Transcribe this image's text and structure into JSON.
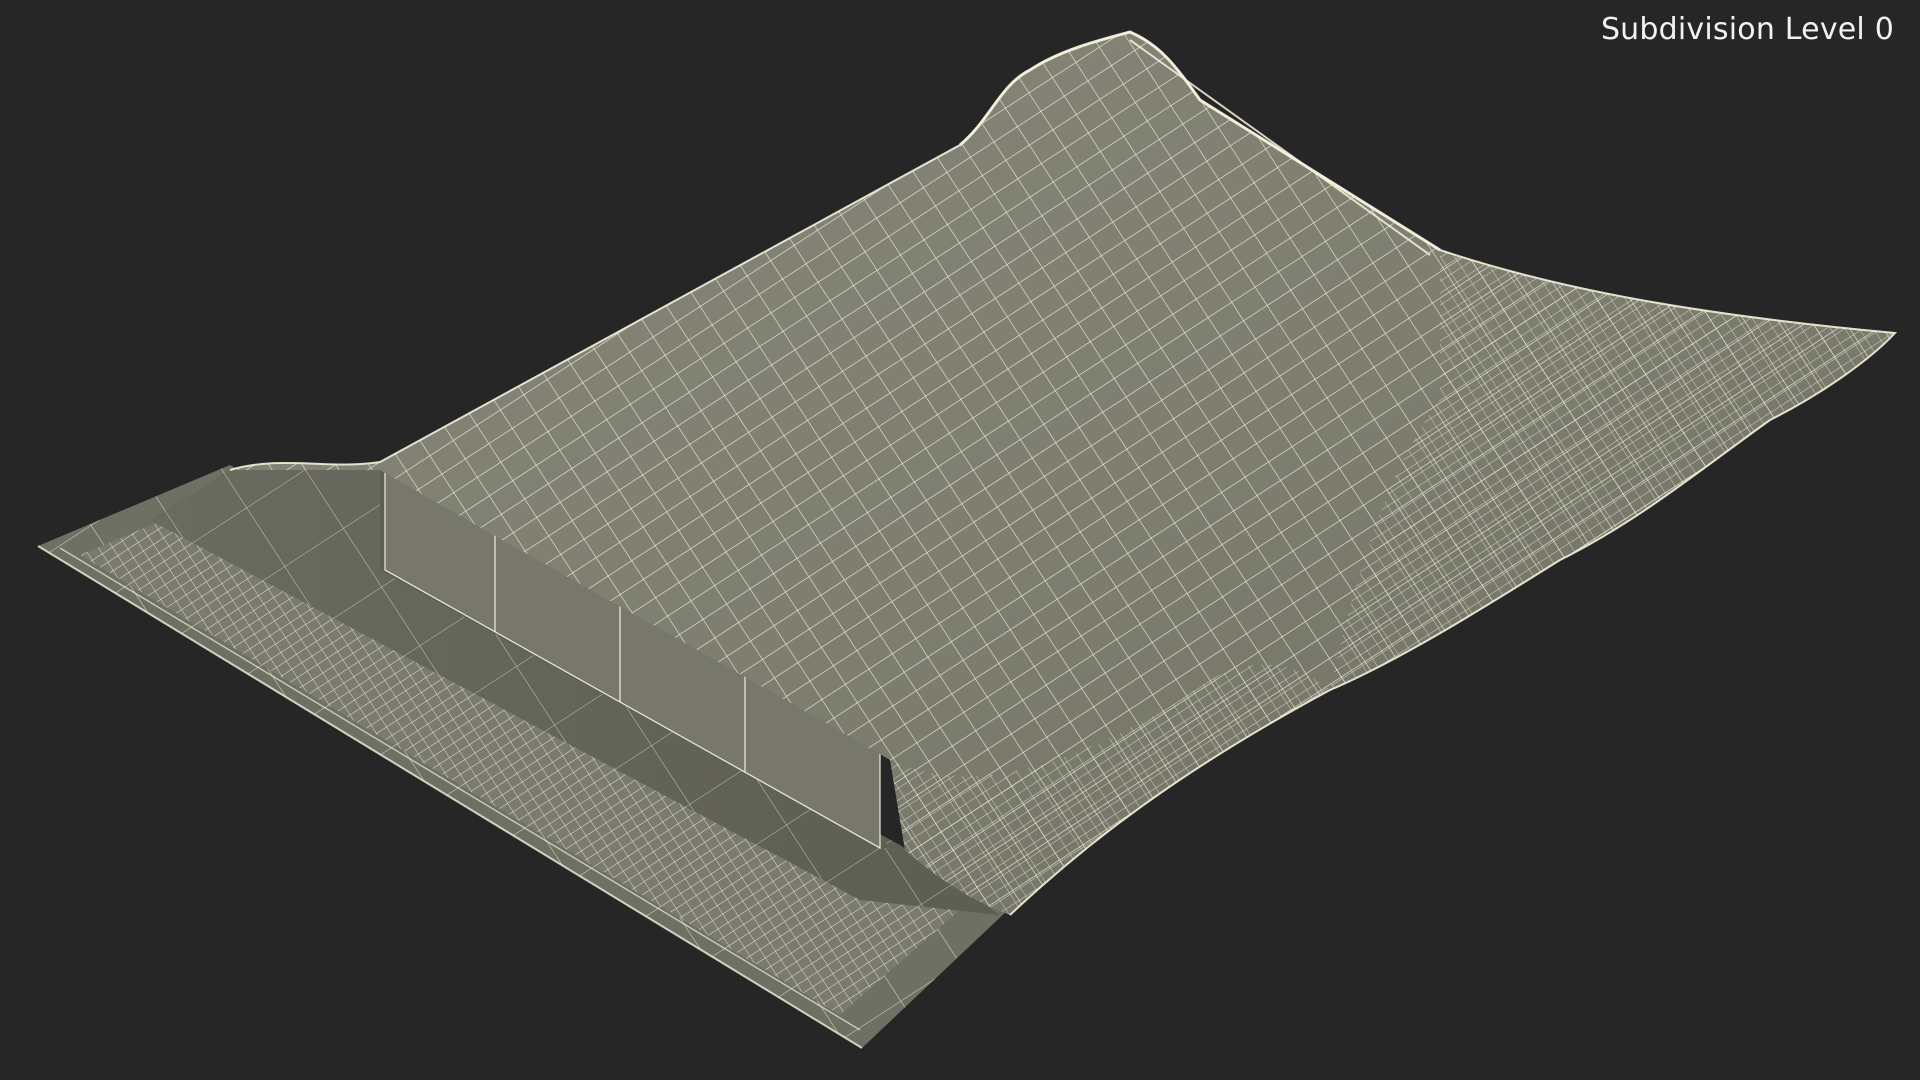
{
  "viewport": {
    "caption": "Subdivision Level 0",
    "background_color": "#262626"
  },
  "model": {
    "subject": "mailer-bag-wireframe",
    "surface_color": "#7d7e70",
    "surface_shadow_color": "#626357",
    "box_color": "#77786b",
    "wire_color": "#f4f1dc"
  }
}
